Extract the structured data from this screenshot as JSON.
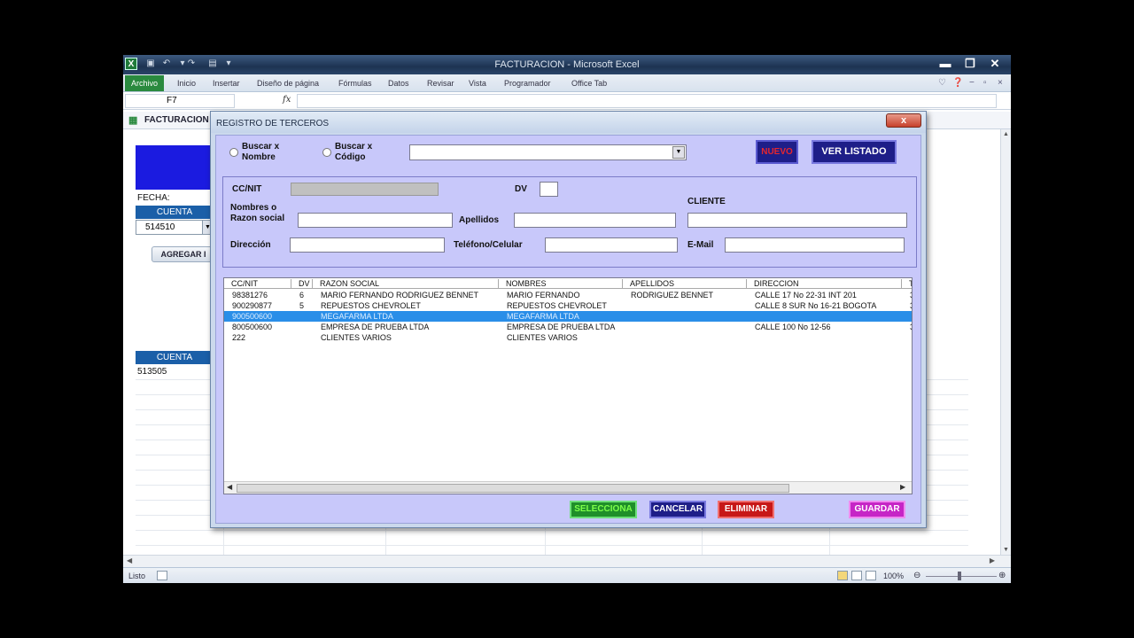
{
  "window": {
    "title": "FACTURACION - Microsoft Excel",
    "minimize": "▬",
    "restore": "❐",
    "close": "✕"
  },
  "ribbon": {
    "file": "Archivo",
    "tabs": [
      "Inicio",
      "Insertar",
      "Diseño de página",
      "Fórmulas",
      "Datos",
      "Revisar",
      "Vista",
      "Programador",
      "Office Tab"
    ]
  },
  "formula_bar": {
    "name_box": "F7",
    "fx": "fx"
  },
  "workbook_tab": "FACTURACION",
  "sheet": {
    "fecha_label": "FECHA:",
    "cuenta_header_1": "CUENTA",
    "cuenta_value": "514510",
    "agregar_button": "AGREGAR I",
    "cuenta_header_2": "CUENTA",
    "cuenta_row_value": "513505"
  },
  "status": {
    "ready": "Listo",
    "zoom": "100%"
  },
  "dialog": {
    "title": "REGISTRO DE TERCEROS",
    "close": "x",
    "search_by_name": "Buscar x\nNombre",
    "search_by_name_l1": "Buscar x",
    "search_by_name_l2": "Nombre",
    "search_by_code_l1": "Buscar x",
    "search_by_code_l2": "Código",
    "search_value": "",
    "nuevo_button": "NUEVO",
    "ver_listado_button": "VER LISTADO",
    "form": {
      "ccnit_label": "CC/NIT",
      "dv_label": "DV",
      "cliente_label": "CLIENTE",
      "nombres_label_l1": "Nombres o",
      "nombres_label_l2": "Razon social",
      "apellidos_label": "Apellidos",
      "direccion_label": "Dirección",
      "telefono_label": "Teléfono/Celular",
      "email_label": "E-Mail"
    },
    "list": {
      "columns": [
        "CC/NIT",
        "DV",
        "RAZON SOCIAL",
        "NOMBRES",
        "APELLIDOS",
        "DIRECCION",
        "T"
      ],
      "rows": [
        [
          "98381276",
          "6",
          "MARIO FERNANDO RODRIGUEZ BENNET",
          "MARIO FERNANDO",
          "RODRIGUEZ BENNET",
          "CALLE 17 No 22-31 INT 201",
          "3"
        ],
        [
          "900290877",
          "5",
          "REPUESTOS CHEVROLET",
          "REPUESTOS CHEVROLET",
          "",
          "CALLE 8 SUR No 16-21 BOGOTA",
          "3"
        ],
        [
          "900500600",
          "",
          "MEGAFARMA LTDA",
          "MEGAFARMA LTDA",
          "",
          "",
          ""
        ],
        [
          "800500600",
          "",
          "EMPRESA DE PRUEBA LTDA",
          "EMPRESA DE PRUEBA LTDA",
          "",
          "CALLE 100 No 12-56",
          "3"
        ],
        [
          "222",
          "",
          "CLIENTES VARIOS",
          "CLIENTES VARIOS",
          "",
          "",
          ""
        ]
      ],
      "selected_row": 2
    },
    "buttons": {
      "seleccionar": "SELECCIONA",
      "cancelar": "CANCELAR",
      "eliminar": "ELIMINAR",
      "guardar": "GUARDAR"
    }
  },
  "colors": {
    "dialog_bg": "#c8c8fa",
    "nuevo_text": "#e6262e",
    "seleccionar_text": "#7cff4a",
    "cancelar_text": "#ffffff",
    "eliminar_text": "#ffffff",
    "guardar_text": "#ffffff",
    "selected_row": "#2a8ee8"
  }
}
